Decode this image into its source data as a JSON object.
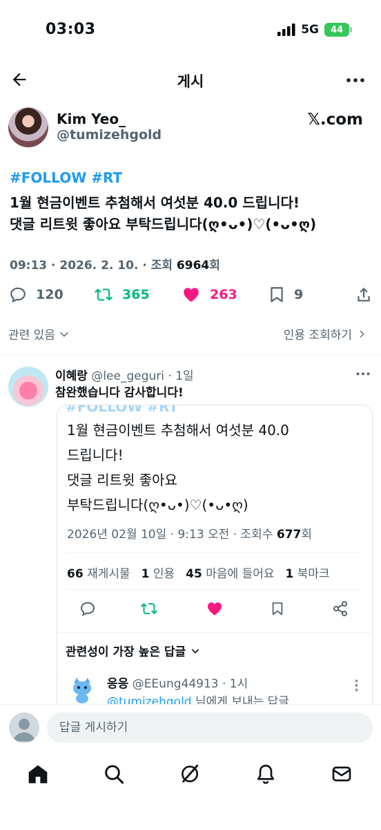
{
  "status_bar": {
    "time": "03:03",
    "network": "5G",
    "battery": "44"
  },
  "header": {
    "title": "게시"
  },
  "post": {
    "author_name": "Kim Yeo_",
    "author_handle": "@tumizehgold",
    "source_label": "𝕏.com",
    "hashtags": "#FOLLOW #RT",
    "line1": "1월 현금이벤트 추첨해서 여섯분 40.0 드립니다!",
    "line2": "댓글 리트윗 좋아요 부탁드립니다(ღ•ᴗ•)♡(•ᴗ•ღ)",
    "meta_prefix": "09:13 · 2026. 2. 10. · 조회 ",
    "views": "6964",
    "views_suffix": "회",
    "stats": {
      "replies": "120",
      "retweets": "365",
      "likes": "263",
      "bookmarks": "9"
    },
    "related_label": "관련 있음",
    "quotes_label": "인용 조회하기"
  },
  "reply": {
    "name": "이혜랑",
    "handle_time": "@lee_geguri · 1일",
    "text": "참완했습니다 감사합니다!",
    "card": {
      "clipped_header": "#FOLLOW #RT",
      "lines": [
        "1월 현금이벤트 추첨해서 여섯분 40.0",
        "드립니다!",
        "댓글 리트윗 좋아요",
        "부탁드립니다(ღ•ᴗ•)♡(•ᴗ•ღ)"
      ],
      "meta_prefix": "2026년 02월 10일 · 9:13 오전 · 조회수 ",
      "views": "677",
      "views_suffix": "회",
      "stats": {
        "retweets_count": "66",
        "retweets_label": "재게시물",
        "quotes_count": "1",
        "quotes_label": "인용",
        "likes_count": "45",
        "likes_label": "마음에 들어요",
        "bookmarks_count": "1",
        "bookmarks_label": "북마크"
      },
      "best_replies_label": "관련성이 가장 높은 답글",
      "sub_reply": {
        "name": "응응",
        "handle_time": "@EEung44913 · 1시",
        "mention": "@tumizehgold",
        "to_text": " 님에게 보내는 답글"
      }
    }
  },
  "compose": {
    "placeholder": "답글 게시하기"
  },
  "colors": {
    "accent": "#1d9bf0",
    "retweet": "#00ba7c",
    "like": "#f91880",
    "muted": "#536471"
  },
  "icons": {
    "header": [
      "back-arrow-icon",
      "more-icon"
    ],
    "actions": [
      "reply-icon",
      "retweet-icon",
      "heart-icon",
      "bookmark-icon",
      "share-icon"
    ],
    "tabs": [
      "home-icon",
      "search-icon",
      "grok-icon",
      "notifications-icon",
      "messages-icon"
    ]
  }
}
